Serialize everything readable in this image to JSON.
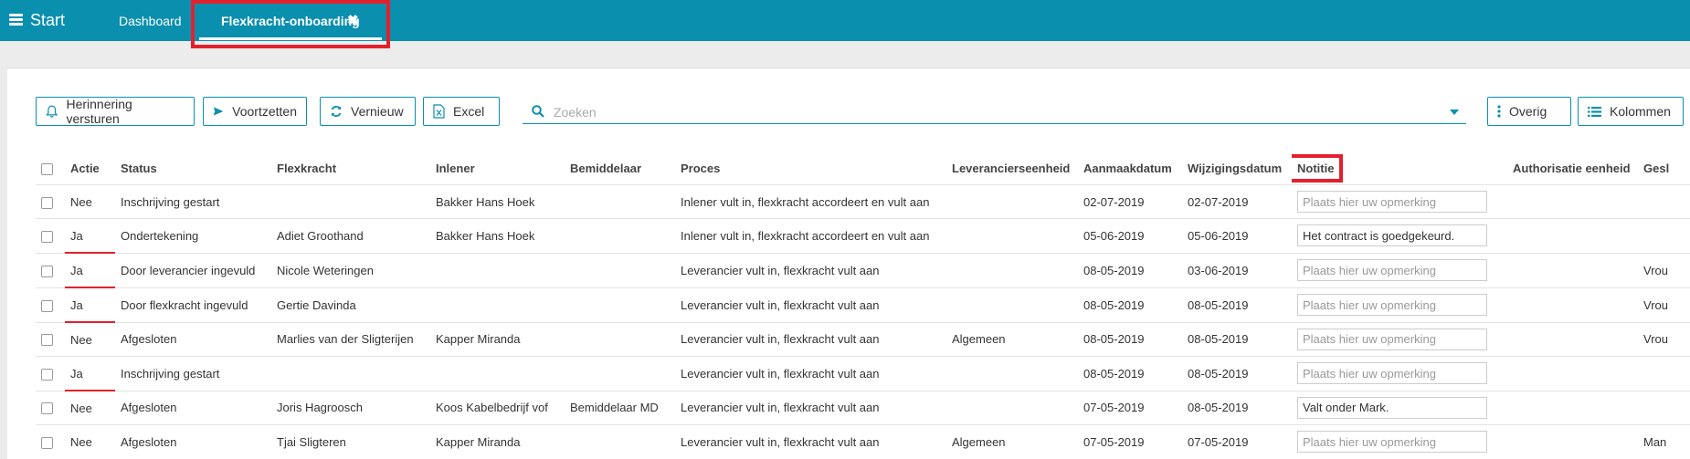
{
  "topbar": {
    "start_label": "Start",
    "tabs": [
      {
        "label": "Dashboard"
      },
      {
        "label": "Flexkracht-onboarding",
        "close": "✖"
      }
    ]
  },
  "toolbar": {
    "reminder_label": "Herinnering versturen",
    "continue_label": "Voortzetten",
    "refresh_label": "Vernieuw",
    "excel_label": "Excel",
    "other_label": "Overig",
    "columns_label": "Kolommen"
  },
  "search": {
    "placeholder": "Zoeken"
  },
  "table": {
    "headers": [
      "Actie",
      "Status",
      "Flexkracht",
      "Inlener",
      "Bemiddelaar",
      "Proces",
      "Leverancierseenheid",
      "Aanmaakdatum",
      "Wijzigingsdatum",
      "Notitie",
      "Authorisatie eenheid",
      "Gesl"
    ],
    "note_placeholder": "Plaats hier uw opmerking",
    "rows": [
      {
        "actie": "Nee",
        "status": "Inschrijving gestart",
        "flexkracht": "",
        "inlener": "Bakker Hans Hoek",
        "bemiddelaar": "",
        "proces": "Inlener vult in, flexkracht accordeert en vult aan",
        "leverancier": "",
        "aanmaak": "02-07-2019",
        "wijziging": "02-07-2019",
        "notitie": "",
        "auth": "",
        "gesl": ""
      },
      {
        "actie": "Ja",
        "status": "Ondertekening",
        "flexkracht": "Adiet Groothand",
        "inlener": "Bakker Hans Hoek",
        "bemiddelaar": "",
        "proces": "Inlener vult in, flexkracht accordeert en vult aan",
        "leverancier": "",
        "aanmaak": "05-06-2019",
        "wijziging": "05-06-2019",
        "notitie": "Het contract is goedgekeurd.",
        "auth": "",
        "gesl": ""
      },
      {
        "actie": "Ja",
        "status": "Door leverancier ingevuld",
        "flexkracht": "Nicole Weteringen",
        "inlener": "",
        "bemiddelaar": "",
        "proces": "Leverancier vult in, flexkracht vult aan",
        "leverancier": "",
        "aanmaak": "08-05-2019",
        "wijziging": "03-06-2019",
        "notitie": "",
        "auth": "",
        "gesl": "Vrou"
      },
      {
        "actie": "Ja",
        "status": "Door flexkracht ingevuld",
        "flexkracht": "Gertie Davinda",
        "inlener": "",
        "bemiddelaar": "",
        "proces": "Leverancier vult in, flexkracht vult aan",
        "leverancier": "",
        "aanmaak": "08-05-2019",
        "wijziging": "08-05-2019",
        "notitie": "",
        "auth": "",
        "gesl": "Vrou"
      },
      {
        "actie": "Nee",
        "status": "Afgesloten",
        "flexkracht": "Marlies van der Sligterijen",
        "inlener": "Kapper Miranda",
        "bemiddelaar": "",
        "proces": "Leverancier vult in, flexkracht vult aan",
        "leverancier": "Algemeen",
        "aanmaak": "08-05-2019",
        "wijziging": "08-05-2019",
        "notitie": "",
        "auth": "",
        "gesl": "Vrou"
      },
      {
        "actie": "Ja",
        "status": "Inschrijving gestart",
        "flexkracht": "",
        "inlener": "",
        "bemiddelaar": "",
        "proces": "Leverancier vult in, flexkracht vult aan",
        "leverancier": "",
        "aanmaak": "08-05-2019",
        "wijziging": "08-05-2019",
        "notitie": "",
        "auth": "",
        "gesl": ""
      },
      {
        "actie": "Nee",
        "status": "Afgesloten",
        "flexkracht": "Joris Hagroosch",
        "inlener": "Koos Kabelbedrijf vof",
        "bemiddelaar": "Bemiddelaar MD",
        "proces": "Leverancier vult in, flexkracht vult aan",
        "leverancier": "",
        "aanmaak": "07-05-2019",
        "wijziging": "08-05-2019",
        "notitie": "Valt onder Mark.",
        "auth": "",
        "gesl": ""
      },
      {
        "actie": "Nee",
        "status": "Afgesloten",
        "flexkracht": "Tjai Sligteren",
        "inlener": "Kapper Miranda",
        "bemiddelaar": "",
        "proces": "Leverancier vult in, flexkracht vult aan",
        "leverancier": "Algemeen",
        "aanmaak": "07-05-2019",
        "wijziging": "07-05-2019",
        "notitie": "",
        "auth": "",
        "gesl": "Man"
      }
    ]
  },
  "colors": {
    "accent": "#0b8fae",
    "highlight": "#e3202e"
  }
}
